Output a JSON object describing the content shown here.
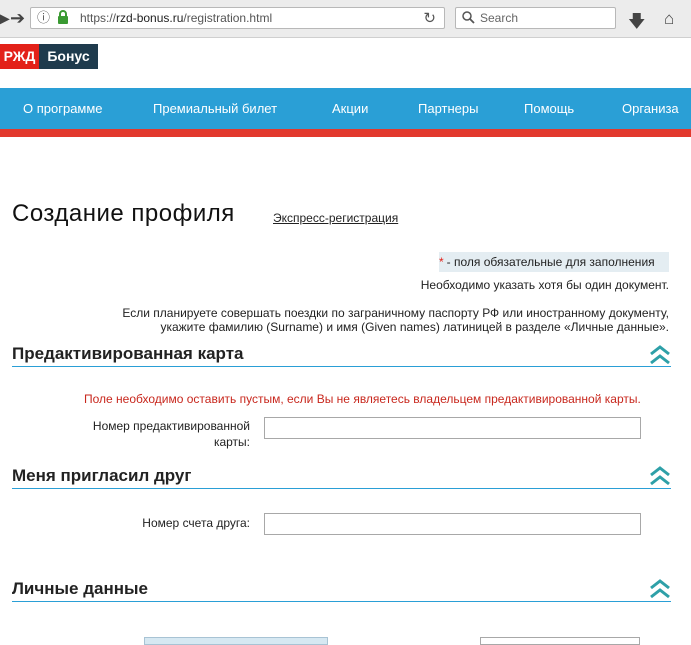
{
  "browser": {
    "url_prefix": "https://",
    "url_host": "rzd-bonus.ru",
    "url_path": "/registration.html",
    "search_placeholder": "Search"
  },
  "logo": {
    "part1": "РЖД",
    "part2": "Бонус"
  },
  "nav": [
    "О программе",
    "Премиальный билет",
    "Акции",
    "Партнеры",
    "Помощь",
    "Организа"
  ],
  "page": {
    "title": "Создание профиля",
    "express_link": "Экспресс-регистрация",
    "required_star": "*",
    "required_note": "- поля обязательные для заполнения",
    "doc_note": "Необходимо указать хотя бы один документ.",
    "passport_note_1": "Если планируете совершать поездки по заграничному паспорту РФ или иностранному документу,",
    "passport_note_2": "укажите фамилию (Surname) и имя (Given names) латиницей в разделе «Личные данные»."
  },
  "sections": {
    "preactivated": {
      "title": "Предактивированная карта",
      "warning": "Поле необходимо оставить пустым, если Вы не являетесь владельцем предактивированной карты.",
      "field_label_1": "Номер предактивированной",
      "field_label_2": "карты:",
      "field_value": ""
    },
    "friend": {
      "title": "Меня пригласил друг",
      "field_label": "Номер счета друга:",
      "field_value": ""
    },
    "personal": {
      "title": "Личные данные"
    }
  },
  "colors": {
    "nav_blue": "#2a9fd6",
    "accent_red": "#e2392d",
    "logo_dark": "#1f3b4d"
  }
}
